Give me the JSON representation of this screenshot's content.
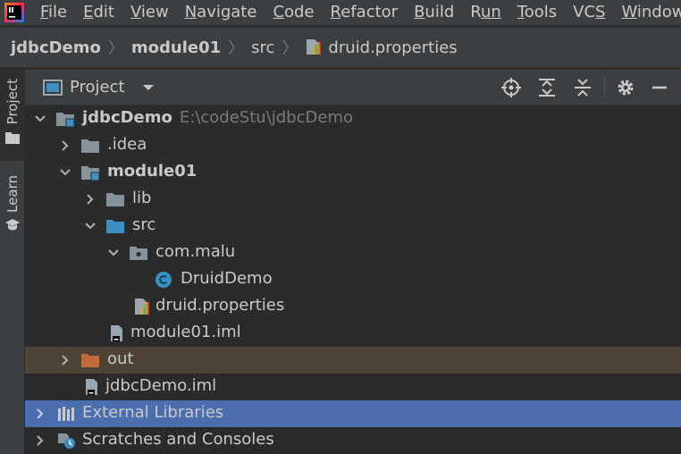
{
  "menubar": {
    "items": [
      {
        "label": "File",
        "ul": "F",
        "rest": "ile"
      },
      {
        "label": "Edit",
        "ul": "E",
        "rest": "dit"
      },
      {
        "label": "View",
        "ul": "V",
        "rest": "iew"
      },
      {
        "label": "Navigate",
        "ul": "N",
        "rest": "avigate"
      },
      {
        "label": "Code",
        "ul": "C",
        "rest": "ode"
      },
      {
        "label": "Refactor",
        "ul": "R",
        "rest": "efactor"
      },
      {
        "label": "Build",
        "ul": "B",
        "rest": "uild"
      },
      {
        "label": "Run",
        "ul": "R",
        "pre": "",
        "rest": "un",
        "ulIndex": 1
      },
      {
        "label": "Tools",
        "ul": "T",
        "rest": "ools"
      },
      {
        "label": "VCS",
        "ul": "S",
        "pre": "VC",
        "rest": ""
      },
      {
        "label": "Window",
        "ul": "W",
        "rest": "indow"
      }
    ]
  },
  "breadcrumb": {
    "items": [
      "jdbcDemo",
      "module01",
      "src",
      "druid.properties"
    ]
  },
  "sidestrip": {
    "tabs": [
      {
        "label": "Project"
      },
      {
        "label": "Learn"
      }
    ]
  },
  "panel": {
    "title": "Project"
  },
  "tree": {
    "rows": [
      {
        "label": "jdbcDemo",
        "hint": "E:\\codeStu\\jdbcDemo"
      },
      {
        "label": ".idea"
      },
      {
        "label": "module01"
      },
      {
        "label": "lib"
      },
      {
        "label": "src"
      },
      {
        "label": "com.malu"
      },
      {
        "label": "DruidDemo"
      },
      {
        "label": "druid.properties"
      },
      {
        "label": "module01.iml"
      },
      {
        "label": "out"
      },
      {
        "label": "jdbcDemo.iml"
      },
      {
        "label": "External Libraries"
      },
      {
        "label": "Scratches and Consoles"
      }
    ]
  },
  "colors": {
    "selection": "#4b6eaf",
    "excluded": "#4d4436",
    "folder": "#87939a",
    "source_folder": "#3d8fc5",
    "out_folder": "#c26a3a",
    "class_icon": "#3592c4"
  }
}
